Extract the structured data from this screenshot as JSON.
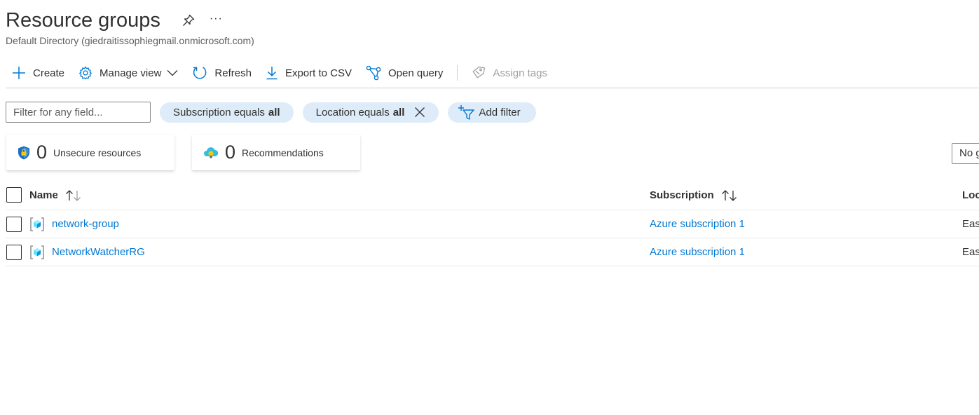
{
  "header": {
    "title": "Resource groups",
    "subtitle": "Default Directory (giedraitissophiegmail.onmicrosoft.com)",
    "more": "···"
  },
  "toolbar": {
    "create": "Create",
    "manage_view": "Manage view",
    "refresh": "Refresh",
    "export_csv": "Export to CSV",
    "open_query": "Open query",
    "assign_tags": "Assign tags"
  },
  "filters": {
    "search_placeholder": "Filter for any field...",
    "subscription_prefix": "Subscription equals",
    "subscription_value": "all",
    "location_prefix": "Location equals",
    "location_value": "all",
    "add_filter": "Add filter"
  },
  "cards": {
    "unsecure": {
      "count": "0",
      "label": "Unsecure resources"
    },
    "recommendations": {
      "count": "0",
      "label": "Recommendations"
    }
  },
  "grouping": {
    "value": "No grouping"
  },
  "table": {
    "columns": {
      "name": "Name",
      "subscription": "Subscription",
      "location": "Location"
    },
    "rows": [
      {
        "name": "network-group",
        "subscription": "Azure subscription 1",
        "location": "East US"
      },
      {
        "name": "NetworkWatcherRG",
        "subscription": "Azure subscription 1",
        "location": "East US"
      }
    ]
  },
  "colors": {
    "link": "#0078d4",
    "pill_bg": "#deecf9",
    "text": "#323130",
    "muted": "#605e5c",
    "disabled": "#a19f9d"
  }
}
